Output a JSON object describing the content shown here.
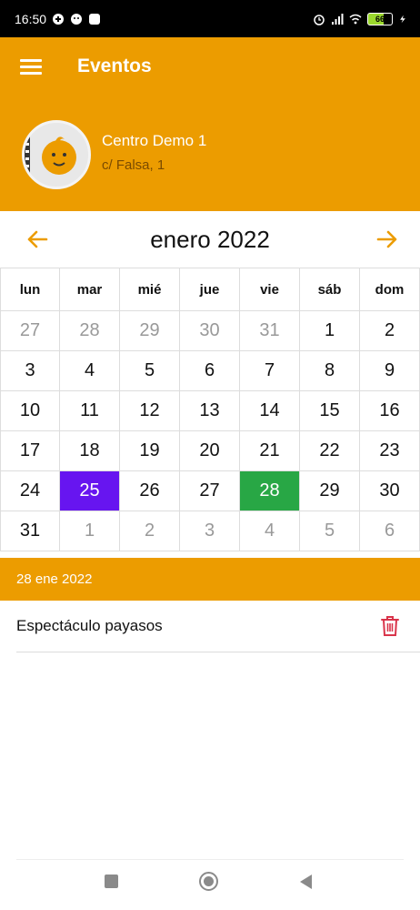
{
  "status_bar": {
    "time": "16:50",
    "battery": "66"
  },
  "header": {
    "title": "Eventos",
    "center_name": "Centro Demo 1",
    "center_address": "c/ Falsa, 1"
  },
  "calendar": {
    "month_label": "enero 2022",
    "weekdays": [
      "lun",
      "mar",
      "mié",
      "jue",
      "vie",
      "sáb",
      "dom"
    ],
    "weeks": [
      [
        {
          "d": "27",
          "o": true
        },
        {
          "d": "28",
          "o": true
        },
        {
          "d": "29",
          "o": true
        },
        {
          "d": "30",
          "o": true
        },
        {
          "d": "31",
          "o": true
        },
        {
          "d": "1"
        },
        {
          "d": "2"
        }
      ],
      [
        {
          "d": "3"
        },
        {
          "d": "4"
        },
        {
          "d": "5"
        },
        {
          "d": "6"
        },
        {
          "d": "7"
        },
        {
          "d": "8"
        },
        {
          "d": "9"
        }
      ],
      [
        {
          "d": "10"
        },
        {
          "d": "11"
        },
        {
          "d": "12"
        },
        {
          "d": "13"
        },
        {
          "d": "14"
        },
        {
          "d": "15"
        },
        {
          "d": "16"
        }
      ],
      [
        {
          "d": "17"
        },
        {
          "d": "18"
        },
        {
          "d": "19"
        },
        {
          "d": "20"
        },
        {
          "d": "21"
        },
        {
          "d": "22"
        },
        {
          "d": "23"
        }
      ],
      [
        {
          "d": "24"
        },
        {
          "d": "25",
          "mark": "purple"
        },
        {
          "d": "26"
        },
        {
          "d": "27"
        },
        {
          "d": "28",
          "mark": "green"
        },
        {
          "d": "29"
        },
        {
          "d": "30"
        }
      ],
      [
        {
          "d": "31"
        },
        {
          "d": "1",
          "o": true
        },
        {
          "d": "2",
          "o": true
        },
        {
          "d": "3",
          "o": true
        },
        {
          "d": "4",
          "o": true
        },
        {
          "d": "5",
          "o": true
        },
        {
          "d": "6",
          "o": true
        }
      ]
    ]
  },
  "selected_date": "28 ene 2022",
  "events": [
    {
      "name": "Espectáculo payasos"
    }
  ],
  "colors": {
    "accent": "#ec9c00",
    "today_marker": "#6715f0",
    "event_marker": "#28a745",
    "delete_icon": "#d9344a"
  },
  "icons": {
    "menu": "hamburger-icon",
    "prev": "arrow-left-icon",
    "next": "arrow-right-icon",
    "delete": "trash-icon"
  }
}
